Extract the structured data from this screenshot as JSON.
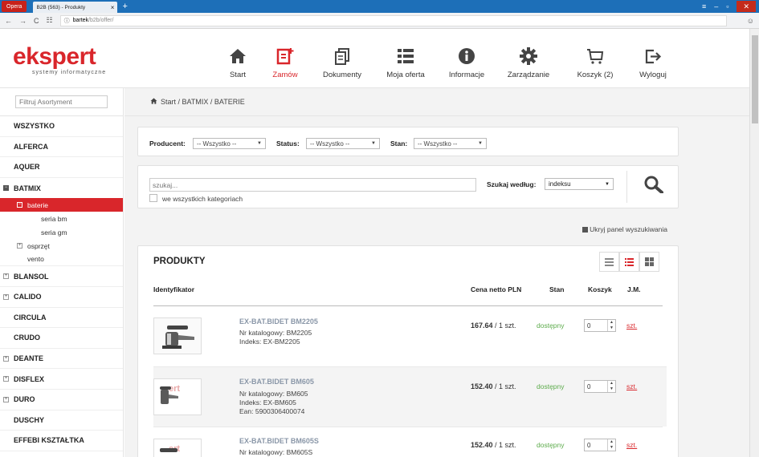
{
  "browser": {
    "opera_label": "Opera",
    "tab_title": "B2B (563) - Produkty",
    "tab_close": "×",
    "new_tab": "+",
    "url_host": "bartek",
    "url_path": "/b2b/offer/"
  },
  "logo": {
    "main": "ekspert",
    "sub": "systemy informatyczne"
  },
  "nav": [
    {
      "label": "Start",
      "icon": "home-icon"
    },
    {
      "label": "Zamów",
      "icon": "order-icon",
      "active": true
    },
    {
      "label": "Dokumenty",
      "icon": "documents-icon"
    },
    {
      "label": "Moja oferta",
      "icon": "list-icon"
    },
    {
      "label": "Informacje",
      "icon": "info-icon"
    },
    {
      "label": "Zarządzanie",
      "icon": "gear-icon"
    },
    {
      "label": "Koszyk (2)",
      "icon": "cart-icon"
    },
    {
      "label": "Wyloguj",
      "icon": "logout-icon"
    }
  ],
  "sidebar": {
    "filter_placeholder": "Filtruj Asortyment",
    "items": [
      "WSZYSTKO",
      "ALFERCA",
      "AQUER",
      "BATMIX"
    ],
    "batmix_sub": {
      "baterie": "baterie",
      "seria_bm": "seria bm",
      "seria_gm": "seria gm",
      "osprzet": "osprzęt",
      "vento": "vento"
    },
    "items_after": [
      "BLANSOL",
      "CALIDO",
      "CIRCULA",
      "CRUDO",
      "DEANTE",
      "DISFLEX",
      "DURO",
      "DUSCHY",
      "EFFEBI KSZTAŁTKA"
    ]
  },
  "breadcrumb": {
    "start": "Start",
    "sep1": " / ",
    "batmix": "BATMIX",
    "sep2": " / ",
    "baterie": "BATERIE"
  },
  "filters": {
    "producer_label": "Producent:",
    "producer_value": "-- Wszystko --",
    "status_label": "Status:",
    "status_value": "-- Wszystko --",
    "state_label": "Stan:",
    "state_value": "-- Wszystko --"
  },
  "search": {
    "placeholder": "szukaj...",
    "all_categories": "we wszystkich kategoriach",
    "by_label": "Szukaj według:",
    "by_value": "indeksu"
  },
  "hide_panel": "Ukryj panel wyszukiwania",
  "products": {
    "title": "PRODUKTY",
    "headers": {
      "id": "Identyfikator",
      "price": "Cena netto PLN",
      "state": "Stan",
      "cart": "Koszyk",
      "unit": "J.M."
    },
    "rows": [
      {
        "name": "EX-BAT.BIDET BM2205",
        "catalog": "Nr katalogowy: BM2205",
        "index": "Indeks: EX-BM2205",
        "ean": "",
        "price": "167.64",
        "per": "/ 1 szt.",
        "state": "dostępny",
        "qty": "0",
        "unit": "szt."
      },
      {
        "name": "EX-BAT.BIDET BM605",
        "catalog": "Nr katalogowy: BM605",
        "index": "Indeks: EX-BM605",
        "ean": "Ean: 5900306400074",
        "price": "152.40",
        "per": "/ 1 szt.",
        "state": "dostępny",
        "qty": "0",
        "unit": "szt."
      },
      {
        "name": "EX-BAT.BIDET BM605S",
        "catalog": "Nr katalogowy: BM605S",
        "index": "",
        "ean": "",
        "price": "152.40",
        "per": "/ 1 szt.",
        "state": "dostępny",
        "qty": "0",
        "unit": "szt."
      }
    ]
  },
  "colors": {
    "brand": "#d9262b",
    "available": "#5cab4b"
  }
}
